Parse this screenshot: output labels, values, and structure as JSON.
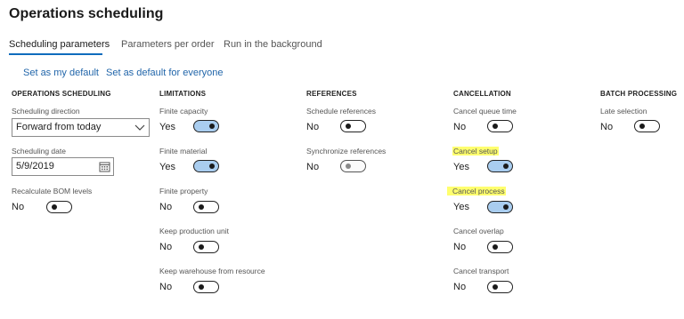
{
  "page": {
    "title": "Operations scheduling"
  },
  "tabs": [
    {
      "label": "Scheduling parameters",
      "active": true
    },
    {
      "label": "Parameters per order",
      "active": false
    },
    {
      "label": "Run in the background",
      "active": false
    }
  ],
  "actions": {
    "set_default": "Set as my default",
    "set_default_everyone": "Set as default for everyone"
  },
  "columns": {
    "operations": "OPERATIONS SCHEDULING",
    "limitations": "LIMITATIONS",
    "references": "REFERENCES",
    "cancellation": "CANCELLATION",
    "batch": "BATCH PROCESSING"
  },
  "operations": {
    "direction_label": "Scheduling direction",
    "direction_value": "Forward from today",
    "date_label": "Scheduling date",
    "date_value": "5/9/2019",
    "bom_label": "Recalculate BOM levels",
    "bom_value": "No"
  },
  "limitations": {
    "finite_capacity_label": "Finite capacity",
    "finite_capacity_value": "Yes",
    "finite_material_label": "Finite material",
    "finite_material_value": "Yes",
    "finite_property_label": "Finite property",
    "finite_property_value": "No",
    "keep_production_unit_label": "Keep production unit",
    "keep_production_unit_value": "No",
    "keep_warehouse_label": "Keep warehouse from resource",
    "keep_warehouse_value": "No"
  },
  "references": {
    "schedule_references_label": "Schedule references",
    "schedule_references_value": "No",
    "synchronize_references_label": "Synchronize references",
    "synchronize_references_value": "No"
  },
  "cancellation": {
    "queue_time_label": "Cancel queue time",
    "queue_time_value": "No",
    "setup_label": "Cancel setup",
    "setup_value": "Yes",
    "process_label": "Cancel process",
    "process_value": "Yes",
    "overlap_label": "Cancel overlap",
    "overlap_value": "No",
    "transport_label": "Cancel transport",
    "transport_value": "No"
  },
  "batch": {
    "late_selection_label": "Late selection",
    "late_selection_value": "No"
  },
  "colors": {
    "accent": "#0f6cbd",
    "link": "#2266aa",
    "toggle_on": "#a9cdef",
    "highlight": "#ffff6e"
  },
  "icons": {
    "dropdown": "chevron-down-icon",
    "date": "calendar-icon"
  }
}
